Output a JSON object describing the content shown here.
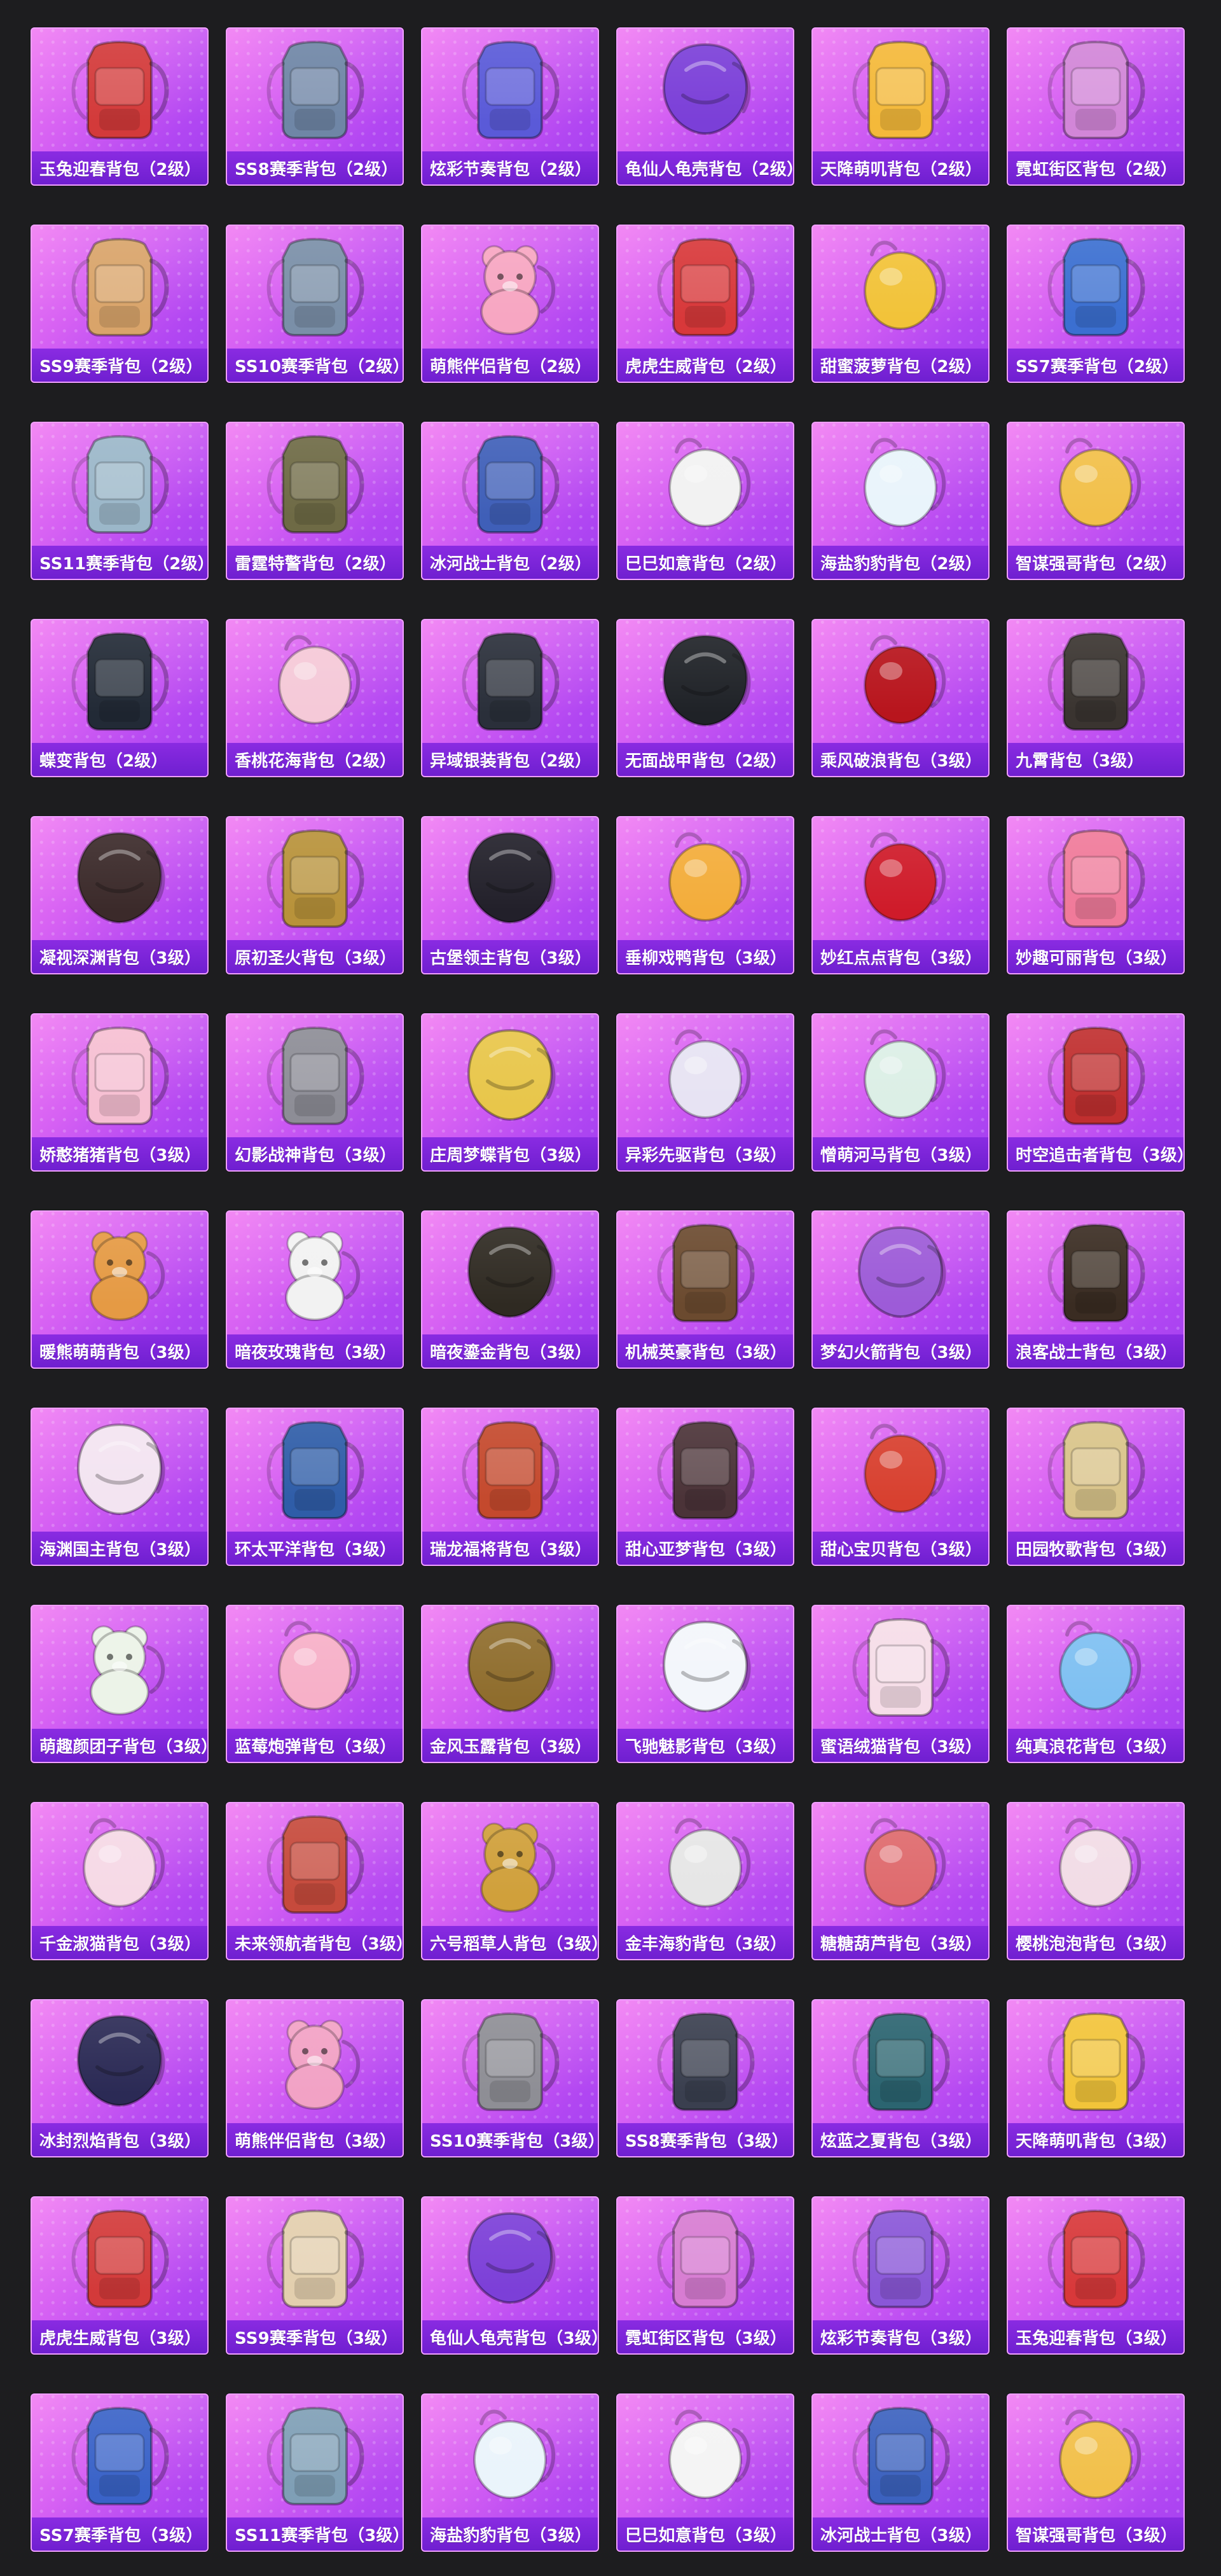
{
  "items": [
    {
      "name": "玉兔迎春背包（2级）",
      "color": "#d33a3a",
      "kind": "pack"
    },
    {
      "name": "SS8赛季背包（2级）",
      "color": "#6f86a6",
      "kind": "pack"
    },
    {
      "name": "炫彩节奏背包（2级）",
      "color": "#5a5ad8",
      "kind": "pack"
    },
    {
      "name": "龟仙人龟壳背包（2级）",
      "color": "#7b3fd8",
      "kind": "shell"
    },
    {
      "name": "天降萌叽背包（2级）",
      "color": "#f4b93a",
      "kind": "pack"
    },
    {
      "name": "霓虹街区背包（2级）",
      "color": "#d286d8",
      "kind": "pack"
    },
    {
      "name": "SS9赛季背包（2级）",
      "color": "#d9a46a",
      "kind": "pack"
    },
    {
      "name": "SS10赛季背包（2级）",
      "color": "#7a8fa8",
      "kind": "pack"
    },
    {
      "name": "萌熊伴侣背包（2级）",
      "color": "#f7a6c2",
      "kind": "bear"
    },
    {
      "name": "虎虎生威背包（2级）",
      "color": "#d8383a",
      "kind": "pack"
    },
    {
      "name": "甜蜜菠萝背包（2级）",
      "color": "#f2c339",
      "kind": "round"
    },
    {
      "name": "SS7赛季背包（2级）",
      "color": "#3b6fd1",
      "kind": "pack"
    },
    {
      "name": "SS11赛季背包（2级）",
      "color": "#9bb7c9",
      "kind": "pack"
    },
    {
      "name": "雷霆特警背包（2级）",
      "color": "#6e6a45",
      "kind": "pack"
    },
    {
      "name": "冰河战士背包（2级）",
      "color": "#3f5fb8",
      "kind": "pack"
    },
    {
      "name": "巳巳如意背包（2级）",
      "color": "#f2f2f2",
      "kind": "round"
    },
    {
      "name": "海盐豹豹背包（2级）",
      "color": "#e9f4fb",
      "kind": "round"
    },
    {
      "name": "智谋强哥背包（2级）",
      "color": "#f2c04a",
      "kind": "round"
    },
    {
      "name": "蝶变背包（2级）",
      "color": "#222a36",
      "kind": "pack"
    },
    {
      "name": "香桃花海背包（2级）",
      "color": "#f5c9d8",
      "kind": "round"
    },
    {
      "name": "异域银装背包（2级）",
      "color": "#2a2f3a",
      "kind": "pack"
    },
    {
      "name": "无面战甲背包（2级）",
      "color": "#1f2227",
      "kind": "shell"
    },
    {
      "name": "乘风破浪背包（3级）",
      "color": "#b8151d",
      "kind": "round"
    },
    {
      "name": "九霄背包（3级）",
      "color": "#3a3430",
      "kind": "pack"
    },
    {
      "name": "凝视深渊背包（3级）",
      "color": "#3b2a2a",
      "kind": "shell"
    },
    {
      "name": "原初圣火背包（3级）",
      "color": "#b8923a",
      "kind": "pack"
    },
    {
      "name": "古堡领主背包（3级）",
      "color": "#22202a",
      "kind": "shell"
    },
    {
      "name": "垂柳戏鸭背包（3级）",
      "color": "#f3ad3b",
      "kind": "round"
    },
    {
      "name": "妙红点点背包（3级）",
      "color": "#cf1b2a",
      "kind": "round"
    },
    {
      "name": "妙趣可丽背包（3级）",
      "color": "#f07a9a",
      "kind": "pack"
    },
    {
      "name": "娇憨猪猪背包（3级）",
      "color": "#f6bfd2",
      "kind": "pack"
    },
    {
      "name": "幻影战神背包（3级）",
      "color": "#8d8d96",
      "kind": "pack"
    },
    {
      "name": "庄周梦蝶背包（3级）",
      "color": "#e8c64a",
      "kind": "shell"
    },
    {
      "name": "异彩先驱背包（3级）",
      "color": "#e7e3f3",
      "kind": "round"
    },
    {
      "name": "憎萌河马背包（3级）",
      "color": "#dcefe6",
      "kind": "round"
    },
    {
      "name": "时空追击者背包（3级）",
      "color": "#c02f2f",
      "kind": "pack"
    },
    {
      "name": "暖熊萌萌背包（3级）",
      "color": "#e59a44",
      "kind": "bear"
    },
    {
      "name": "暗夜玫瑰背包（3级）",
      "color": "#f2f2f2",
      "kind": "bear"
    },
    {
      "name": "暗夜鎏金背包（3级）",
      "color": "#2f2a22",
      "kind": "shell"
    },
    {
      "name": "机械英豪背包（3级）",
      "color": "#6b4a2f",
      "kind": "pack"
    },
    {
      "name": "梦幻火箭背包（3级）",
      "color": "#9d5bd8",
      "kind": "shell"
    },
    {
      "name": "浪客战士背包（3级）",
      "color": "#3a2c22",
      "kind": "pack"
    },
    {
      "name": "海渊国主背包（3级）",
      "color": "#f3e4f1",
      "kind": "shell"
    },
    {
      "name": "环太平洋背包（3级）",
      "color": "#2f5da8",
      "kind": "pack"
    },
    {
      "name": "瑞龙福将背包（3级）",
      "color": "#c4492d",
      "kind": "pack"
    },
    {
      "name": "甜心亚梦背包（3级）",
      "color": "#4b3338",
      "kind": "pack"
    },
    {
      "name": "甜心宝贝背包（3级）",
      "color": "#d8402f",
      "kind": "round"
    },
    {
      "name": "田园牧歌背包（3级）",
      "color": "#d9c48a",
      "kind": "pack"
    },
    {
      "name": "萌趣颜团子背包（3级）",
      "color": "#ecf3e8",
      "kind": "bear"
    },
    {
      "name": "蓝莓炮弹背包（3级）",
      "color": "#f7b0c8",
      "kind": "round"
    },
    {
      "name": "金风玉露背包（3级）",
      "color": "#8f6d2d",
      "kind": "shell"
    },
    {
      "name": "飞驰魅影背包（3级）",
      "color": "#f3f6fb",
      "kind": "shell"
    },
    {
      "name": "蜜语绒猫背包（3级）",
      "color": "#f6dde8",
      "kind": "pack"
    },
    {
      "name": "纯真浪花背包（3级）",
      "color": "#7fc0f2",
      "kind": "round"
    },
    {
      "name": "千金淑猫背包（3级）",
      "color": "#f6d9e6",
      "kind": "round"
    },
    {
      "name": "未来领航者背包（3级）",
      "color": "#c64a3c",
      "kind": "pack"
    },
    {
      "name": "六号稻草人背包（3级）",
      "color": "#d0a03b",
      "kind": "bear"
    },
    {
      "name": "金丰海豹背包（3级）",
      "color": "#e6e6e6",
      "kind": "round"
    },
    {
      "name": "糖糖葫芦背包（3级）",
      "color": "#df6b6e",
      "kind": "round"
    },
    {
      "name": "樱桃泡泡背包（3级）",
      "color": "#f2dce6",
      "kind": "round"
    },
    {
      "name": "冰封烈焰背包（3级）",
      "color": "#2b2a55",
      "kind": "shell"
    },
    {
      "name": "萌熊伴侣背包（3级）",
      "color": "#f2a2c5",
      "kind": "bear"
    },
    {
      "name": "SS10赛季背包（3级）",
      "color": "#8e8e95",
      "kind": "pack"
    },
    {
      "name": "SS8赛季背包（3级）",
      "color": "#3a3f4f",
      "kind": "pack"
    },
    {
      "name": "炫蓝之夏背包（3级）",
      "color": "#2b6470",
      "kind": "pack"
    },
    {
      "name": "天降萌叽背包（3级）",
      "color": "#f2c43a",
      "kind": "pack"
    },
    {
      "name": "虎虎生威背包（3级）",
      "color": "#d33a3a",
      "kind": "pack"
    },
    {
      "name": "SS9赛季背包（3级）",
      "color": "#e3cfae",
      "kind": "pack"
    },
    {
      "name": "龟仙人龟壳背包（3级）",
      "color": "#7c3fd8",
      "kind": "shell"
    },
    {
      "name": "霓虹街区背包（3级）",
      "color": "#d77cd2",
      "kind": "pack"
    },
    {
      "name": "炫彩节奏背包（3级）",
      "color": "#8a57d8",
      "kind": "pack"
    },
    {
      "name": "玉兔迎春背包（3级）",
      "color": "#d8383a",
      "kind": "pack"
    },
    {
      "name": "SS7赛季背包（3级）",
      "color": "#3a63c8",
      "kind": "pack"
    },
    {
      "name": "SS11赛季背包（3级）",
      "color": "#7f9fb6",
      "kind": "pack"
    },
    {
      "name": "海盐豹豹背包（3级）",
      "color": "#eaf4fb",
      "kind": "round"
    },
    {
      "name": "巳巳如意背包（3级）",
      "color": "#f4f4f4",
      "kind": "round"
    },
    {
      "name": "冰河战士背包（3级）",
      "color": "#3c62bf",
      "kind": "pack"
    },
    {
      "name": "智谋强哥背包（3级）",
      "color": "#f2c04a",
      "kind": "round"
    }
  ]
}
